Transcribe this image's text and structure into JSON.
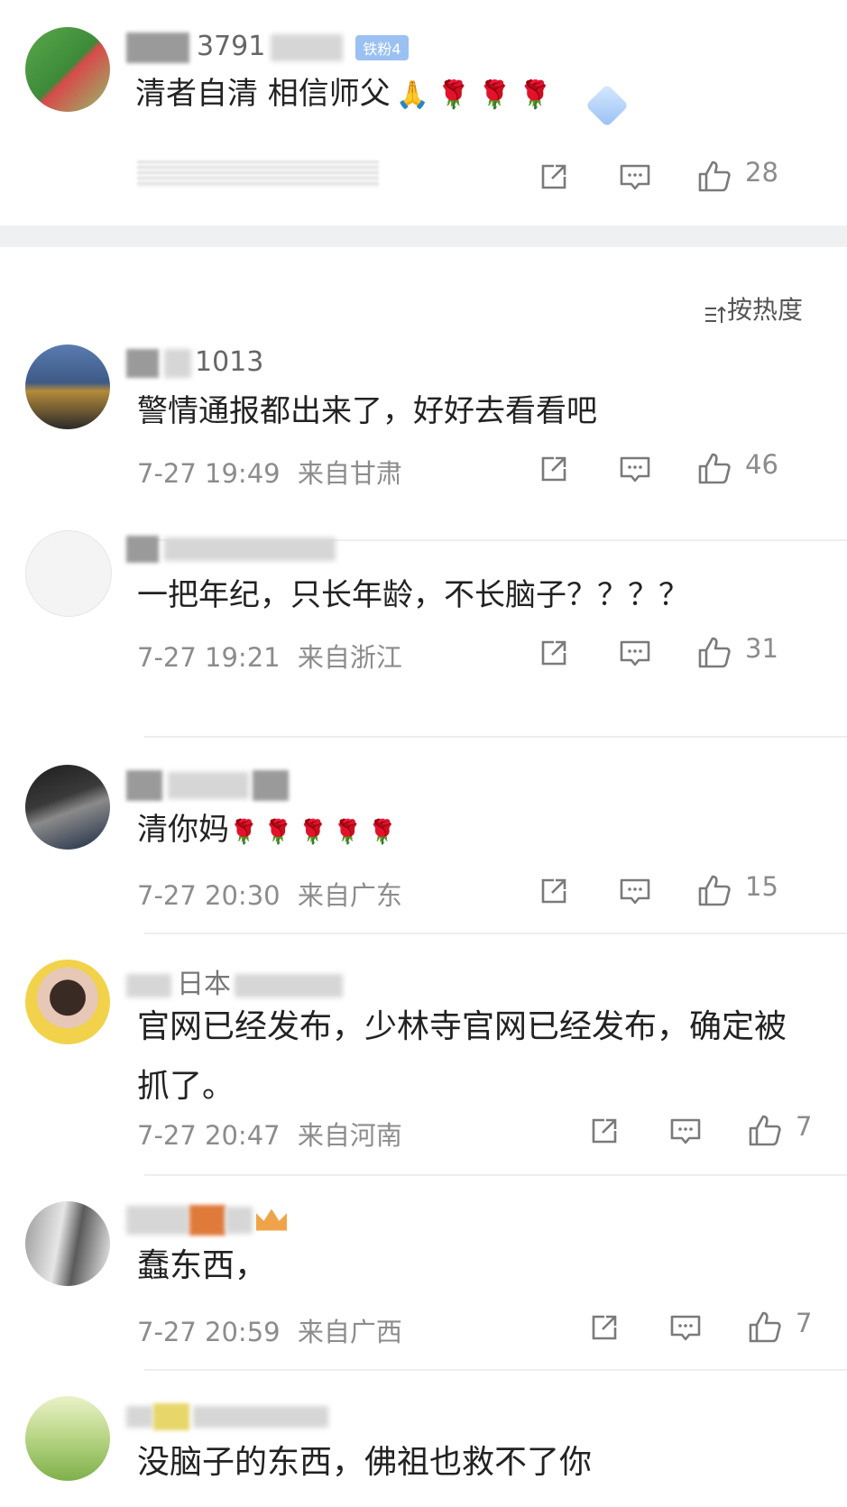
{
  "top_comment": {
    "username": "3791",
    "badge": "铁粉4",
    "text": "清者自清 相信师父",
    "emoji": "🙏🌹🌹🌹",
    "like_count": "28"
  },
  "sort_label": "按热度",
  "comments": [
    {
      "username": "1013",
      "text": "警情通报都出来了，好好去看看吧",
      "time": "7-27 19:49",
      "location": "来自甘肃",
      "likes": "46"
    },
    {
      "username": "",
      "text": "一把年纪，只长年龄，不长脑子？？？？",
      "time": "7-27 19:21",
      "location": "来自浙江",
      "likes": "31"
    },
    {
      "username": "",
      "text": "清你妈",
      "emoji": "🌹🌹🌹🌹🌹",
      "time": "7-27 20:30",
      "location": "来自广东",
      "likes": "15"
    },
    {
      "username": "日本",
      "text": "官网已经发布，少林寺官网已经发布，确定被抓了。",
      "time": "7-27 20:47",
      "location": "来自河南",
      "likes": "7"
    },
    {
      "username": "",
      "text": "蠢东西，",
      "time": "7-27 20:59",
      "location": "来自广西",
      "likes": "7"
    },
    {
      "username": "",
      "text": "没脑子的东西，佛祖也救不了你",
      "time": "",
      "location": "",
      "likes": ""
    }
  ],
  "icons": [
    "share-icon",
    "comment-icon",
    "like-icon",
    "sort-icon"
  ],
  "colors": {
    "text": "#222222",
    "meta": "#8c8c8c",
    "separator": "#eef0f2",
    "rose": "#d23a2c"
  }
}
